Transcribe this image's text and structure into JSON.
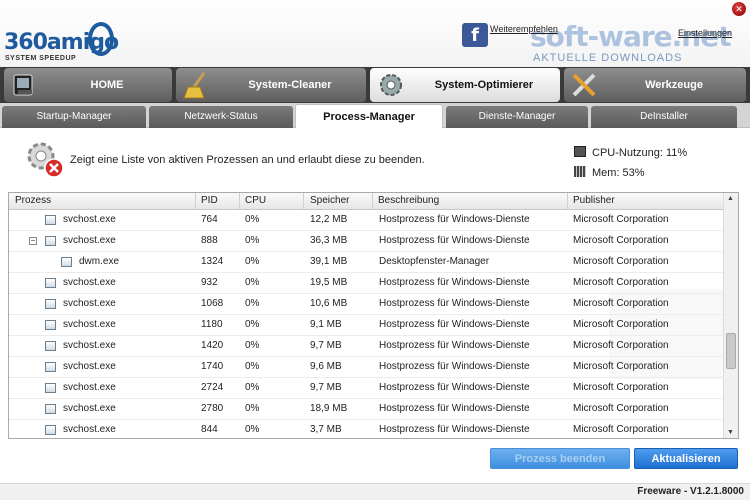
{
  "header": {
    "logo_text": "360amigo",
    "logo_sub": "SYSTEM SPEEDUP",
    "recommend_link": "Weiterempfehlen",
    "settings_link": "Einstellungen",
    "watermark": "soft-ware.net",
    "watermark_sub": "AKTUELLE DOWNLOADS"
  },
  "main_tabs": [
    {
      "label": "HOME",
      "icon": "home-icon"
    },
    {
      "label": "System-Cleaner",
      "icon": "broom-icon"
    },
    {
      "label": "System-Optimierer",
      "icon": "gear-icon"
    },
    {
      "label": "Werkzeuge",
      "icon": "tools-icon"
    }
  ],
  "sub_tabs": [
    "Startup-Manager",
    "Netzwerk-Status",
    "Process-Manager",
    "Dienste-Manager",
    "DeInstaller"
  ],
  "info": {
    "text": "Zeigt eine Liste von aktiven Prozessen an und erlaubt diese zu beenden.",
    "cpu": "CPU-Nutzung: 11%",
    "mem": "Mem: 53%"
  },
  "table": {
    "columns": [
      "Prozess",
      "PID",
      "CPU",
      "Speicher",
      "Beschreibung",
      "Publisher"
    ],
    "rows": [
      {
        "name": "svchost.exe",
        "pid": "764",
        "cpu": "0%",
        "mem": "12,2 MB",
        "desc": "Hostprozess für Windows-Dienste",
        "pub": "Microsoft Corporation"
      },
      {
        "name": "svchost.exe",
        "pid": "888",
        "cpu": "0%",
        "mem": "36,3 MB",
        "desc": "Hostprozess für Windows-Dienste",
        "pub": "Microsoft Corporation"
      },
      {
        "name": "dwm.exe",
        "pid": "1324",
        "cpu": "0%",
        "mem": "39,1 MB",
        "desc": "Desktopfenster-Manager",
        "pub": "Microsoft Corporation"
      },
      {
        "name": "svchost.exe",
        "pid": "932",
        "cpu": "0%",
        "mem": "19,5 MB",
        "desc": "Hostprozess für Windows-Dienste",
        "pub": "Microsoft Corporation"
      },
      {
        "name": "svchost.exe",
        "pid": "1068",
        "cpu": "0%",
        "mem": "10,6 MB",
        "desc": "Hostprozess für Windows-Dienste",
        "pub": "Microsoft Corporation"
      },
      {
        "name": "svchost.exe",
        "pid": "1180",
        "cpu": "0%",
        "mem": "9,1 MB",
        "desc": "Hostprozess für Windows-Dienste",
        "pub": "Microsoft Corporation"
      },
      {
        "name": "svchost.exe",
        "pid": "1420",
        "cpu": "0%",
        "mem": "9,7 MB",
        "desc": "Hostprozess für Windows-Dienste",
        "pub": "Microsoft Corporation"
      },
      {
        "name": "svchost.exe",
        "pid": "1740",
        "cpu": "0%",
        "mem": "9,6 MB",
        "desc": "Hostprozess für Windows-Dienste",
        "pub": "Microsoft Corporation"
      },
      {
        "name": "svchost.exe",
        "pid": "2724",
        "cpu": "0%",
        "mem": "9,7 MB",
        "desc": "Hostprozess für Windows-Dienste",
        "pub": "Microsoft Corporation"
      },
      {
        "name": "svchost.exe",
        "pid": "2780",
        "cpu": "0%",
        "mem": "18,9 MB",
        "desc": "Hostprozess für Windows-Dienste",
        "pub": "Microsoft Corporation"
      },
      {
        "name": "svchost.exe",
        "pid": "844",
        "cpu": "0%",
        "mem": "3,7 MB",
        "desc": "Hostprozess für Windows-Dienste",
        "pub": "Microsoft Corporation"
      }
    ]
  },
  "buttons": {
    "end_process": "Prozess beenden",
    "refresh": "Aktualisieren"
  },
  "footer": {
    "version": "Freeware - V1.2.1.8000"
  }
}
